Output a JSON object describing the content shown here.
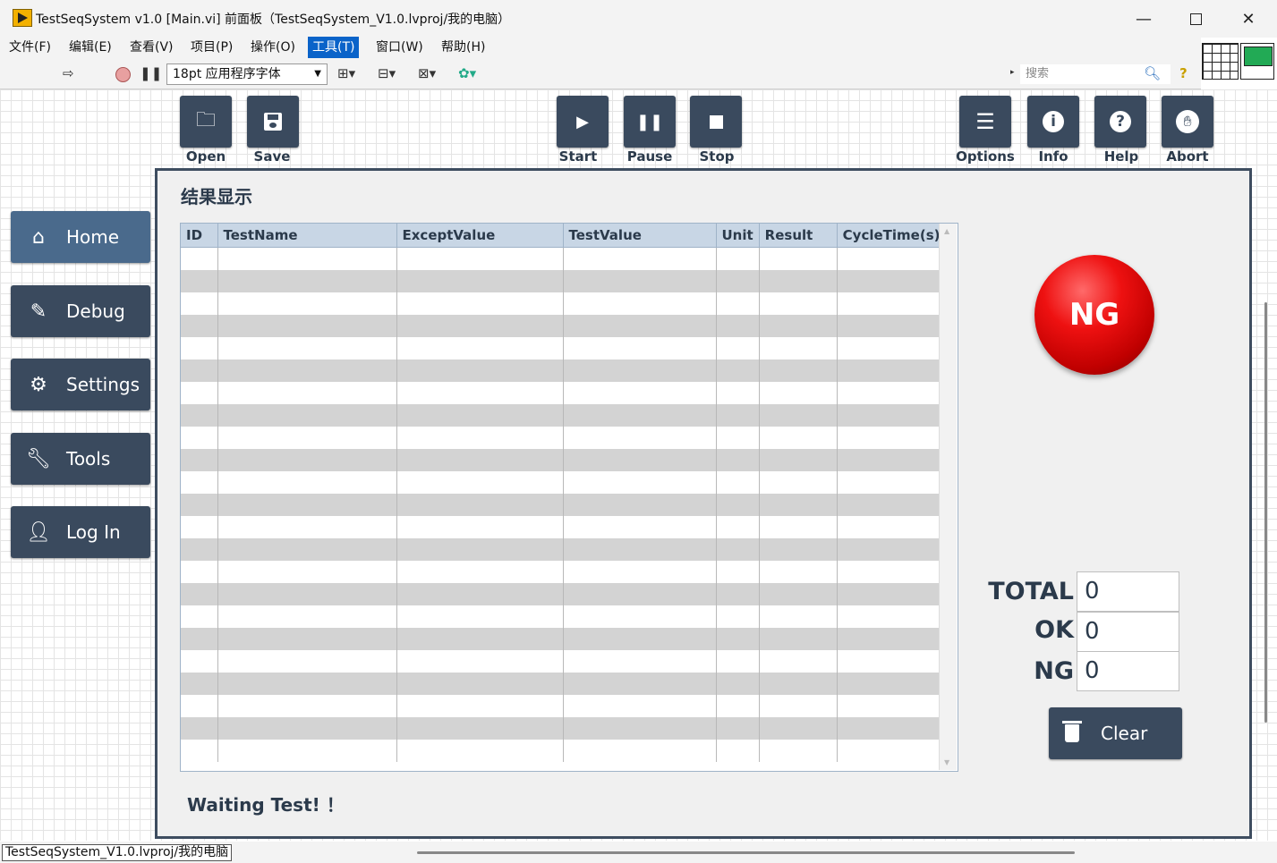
{
  "window": {
    "title": "TestSeqSystem v1.0 [Main.vi] 前面板（TestSeqSystem_V1.0.lvproj/我的电脑）",
    "minimize_icon": "minimize-icon",
    "maximize_icon": "maximize-icon",
    "close_icon": "close-icon"
  },
  "menu": {
    "items": [
      "文件(F)",
      "编辑(E)",
      "查看(V)",
      "项目(P)",
      "操作(O)",
      "工具(T)",
      "窗口(W)",
      "帮助(H)"
    ],
    "active": "工具(T)"
  },
  "toolbar": {
    "font": "18pt 应用程序字体",
    "search_placeholder": "搜索"
  },
  "top_buttons": {
    "open": "Open",
    "save": "Save",
    "start": "Start",
    "pause": "Pause",
    "stop": "Stop",
    "options": "Options",
    "info": "Info",
    "help": "Help",
    "abort": "Abort"
  },
  "nav": {
    "home": "Home",
    "debug": "Debug",
    "settings": "Settings",
    "tools": "Tools",
    "login": "Log In"
  },
  "panel": {
    "title": "结果显示",
    "columns": [
      "ID",
      "TestName",
      "ExceptValue",
      "TestValue",
      "Unit",
      "Result",
      "CycleTime(s)"
    ],
    "status_message": "Waiting Test! ！"
  },
  "indicator": {
    "label": "NG",
    "color": "#e00000"
  },
  "counters": {
    "total_label": "TOTAL",
    "total_value": "0",
    "ok_label": "OK",
    "ok_value": "0",
    "ng_label": "NG",
    "ng_value": "0"
  },
  "clear_button": "Clear",
  "statusbar": {
    "project": "TestSeqSystem_V1.0.lvproj/我的电脑"
  },
  "colors": {
    "button_bg": "#3a4a5e",
    "header_bg": "#c8d6e5",
    "menu_active": "#0a63c9"
  }
}
